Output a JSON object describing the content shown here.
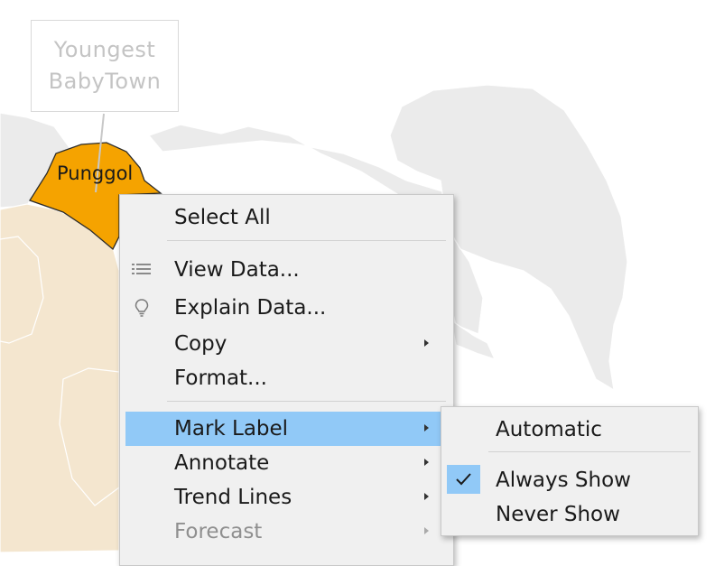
{
  "map": {
    "annotation_lines": [
      "Youngest",
      "BabyTown"
    ],
    "selected_region_label": "Punggol",
    "colors": {
      "region_default": "#ebebeb",
      "region_beige": "#f4e6cf",
      "region_selected": "#f5a300"
    }
  },
  "context_menu": {
    "items": [
      {
        "label": "Select All",
        "icon": "",
        "submenu": false,
        "disabled": false
      },
      {
        "label": "View Data...",
        "icon": "table-icon",
        "submenu": false,
        "disabled": false
      },
      {
        "label": "Explain Data...",
        "icon": "lightbulb-icon",
        "submenu": false,
        "disabled": false
      },
      {
        "label": "Copy",
        "icon": "",
        "submenu": true,
        "disabled": false
      },
      {
        "label": "Format...",
        "icon": "",
        "submenu": false,
        "disabled": false
      },
      {
        "label": "Mark Label",
        "icon": "",
        "submenu": true,
        "disabled": false,
        "highlighted": true
      },
      {
        "label": "Annotate",
        "icon": "",
        "submenu": true,
        "disabled": false
      },
      {
        "label": "Trend Lines",
        "icon": "",
        "submenu": true,
        "disabled": false
      },
      {
        "label": "Forecast",
        "icon": "",
        "submenu": true,
        "disabled": true
      }
    ],
    "highlight_color": "#91c9f7"
  },
  "submenu": {
    "items": [
      {
        "label": "Automatic",
        "checked": false
      },
      {
        "label": "Always Show",
        "checked": true
      },
      {
        "label": "Never Show",
        "checked": false
      }
    ]
  }
}
